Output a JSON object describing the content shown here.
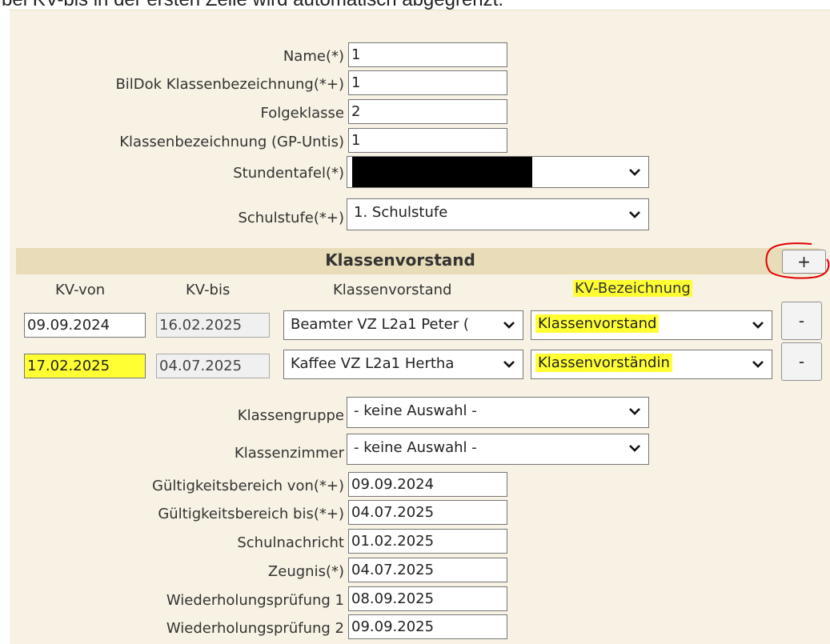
{
  "caption": "bei KV-bis in der ersten Zeile wird automatisch abgegrenzt.",
  "fields": {
    "name": {
      "label": "Name(*)",
      "value": "1"
    },
    "bildok": {
      "label": "BilDok Klassenbezeichnung(*+)",
      "value": "1"
    },
    "folgeklasse": {
      "label": "Folgeklasse",
      "value": "2"
    },
    "gp_untis": {
      "label": "Klassenbezeichnung (GP-Untis)",
      "value": "1"
    },
    "stundentafel": {
      "label": "Stundentafel(*)",
      "value": ""
    },
    "schulstufe": {
      "label": "Schulstufe(*+)",
      "value": "1. Schulstufe"
    }
  },
  "kv_section": {
    "title": "Klassenvorstand",
    "add_label": "+",
    "remove_label": "-",
    "columns": {
      "von": "KV-von",
      "bis": "KV-bis",
      "vorstand": "Klassenvorstand",
      "bezeichnung": "KV-Bezeichnung"
    },
    "rows": [
      {
        "von": "09.09.2024",
        "bis": "16.02.2025",
        "vorstand": "Beamter VZ L2a1 Peter (",
        "bezeichnung": "Klassenvorstand"
      },
      {
        "von": "17.02.2025",
        "bis": "04.07.2025",
        "vorstand": "Kaffee VZ L2a1 Hertha",
        "bezeichnung": "Klassenvorständin"
      }
    ]
  },
  "lower": {
    "klassengruppe": {
      "label": "Klassengruppe",
      "value": "- keine Auswahl -"
    },
    "klassenzimmer": {
      "label": "Klassenzimmer",
      "value": "- keine Auswahl -"
    },
    "gueltig_von": {
      "label": "Gültigkeitsbereich von(*+)",
      "value": "09.09.2024"
    },
    "gueltig_bis": {
      "label": "Gültigkeitsbereich bis(*+)",
      "value": "04.07.2025"
    },
    "schulnachricht": {
      "label": "Schulnachricht",
      "value": "01.02.2025"
    },
    "zeugnis": {
      "label": "Zeugnis(*)",
      "value": "04.07.2025"
    },
    "wdh1": {
      "label": "Wiederholungsprüfung 1",
      "value": "08.09.2025"
    },
    "wdh2": {
      "label": "Wiederholungsprüfung 2",
      "value": "09.09.2025"
    }
  },
  "colors": {
    "highlight": "#ffff33",
    "panel": "#f7f2e3",
    "section": "#e9dcb8",
    "annotation_circle": "#e00000"
  },
  "icons": {
    "dropdown": "chevron-down-icon"
  }
}
